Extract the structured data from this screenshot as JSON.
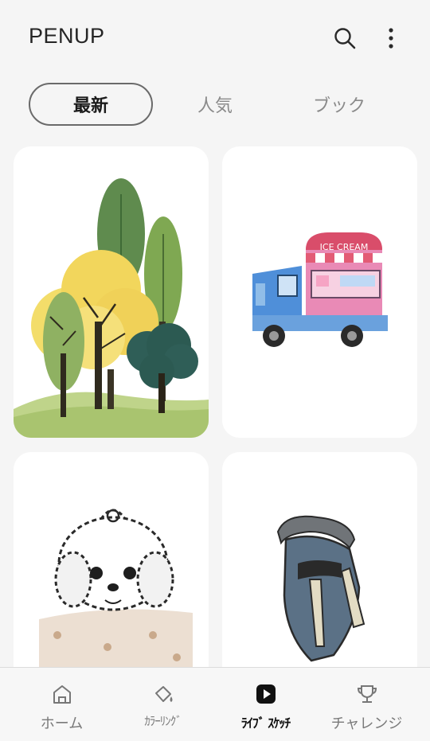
{
  "app": {
    "title": "PENUP"
  },
  "header": {
    "search_icon": "search-icon",
    "more_icon": "more-vertical-icon"
  },
  "tabs": [
    {
      "label": "最新",
      "active": true
    },
    {
      "label": "人気",
      "active": false
    },
    {
      "label": "ブック",
      "active": false
    }
  ],
  "artworks": [
    {
      "subject": "trees-illustration"
    },
    {
      "subject": "ice-cream-truck-illustration",
      "truck_sign": "ICE CREAM"
    },
    {
      "subject": "white-dog-illustration"
    },
    {
      "subject": "spartan-helmet-illustration"
    }
  ],
  "bottom_nav": [
    {
      "label": "ホーム",
      "icon": "home-icon",
      "active": false
    },
    {
      "label": "ｶﾗｰﾘﾝｸﾞ",
      "icon": "paint-bucket-icon",
      "active": false
    },
    {
      "label": "ﾗｲﾌﾞ ｽｹｯﾁ",
      "icon": "play-icon",
      "active": true
    },
    {
      "label": "チャレンジ",
      "icon": "trophy-icon",
      "active": false
    }
  ],
  "colors": {
    "background": "#f5f5f5",
    "card": "#ffffff",
    "active_tab_border": "#6a6a6a",
    "inactive_text": "#8a8a8a"
  }
}
